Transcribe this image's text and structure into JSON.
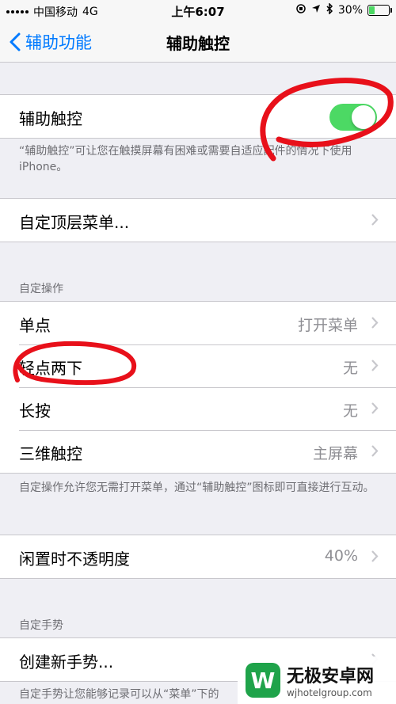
{
  "status_bar": {
    "carrier": "中国移动",
    "network": "4G",
    "time": "上午6:07",
    "battery": "30%",
    "battery_level": 0.3
  },
  "nav": {
    "back_label": "辅助功能",
    "title": "辅助触控"
  },
  "assistive_touch": {
    "label": "辅助触控",
    "enabled": true,
    "footer": "“辅助触控”可让您在触摸屏幕有困难或需要自适应配件的情况下使用 iPhone。"
  },
  "top_level_menu": {
    "label": "自定顶层菜单..."
  },
  "custom_actions": {
    "header": "自定操作",
    "rows": [
      {
        "label": "单点",
        "value": "打开菜单"
      },
      {
        "label": "轻点两下",
        "value": "无"
      },
      {
        "label": "长按",
        "value": "无"
      },
      {
        "label": "三维触控",
        "value": "主屏幕"
      }
    ],
    "footer": "自定操作允许您无需打开菜单，通过“辅助触控”图标即可直接进行互动。"
  },
  "idle_opacity": {
    "label": "闲置时不透明度",
    "value": "40%"
  },
  "custom_gestures": {
    "header": "自定手势",
    "create_label": "创建新手势...",
    "footer": "自定手势让您能够记录可以从“菜单”下的"
  },
  "watermark": {
    "title": "无极安卓网",
    "url": "wjhotelgroup.com"
  },
  "colors": {
    "accent": "#007aff",
    "toggle_on": "#4cd964",
    "annotation": "#e8101a"
  }
}
